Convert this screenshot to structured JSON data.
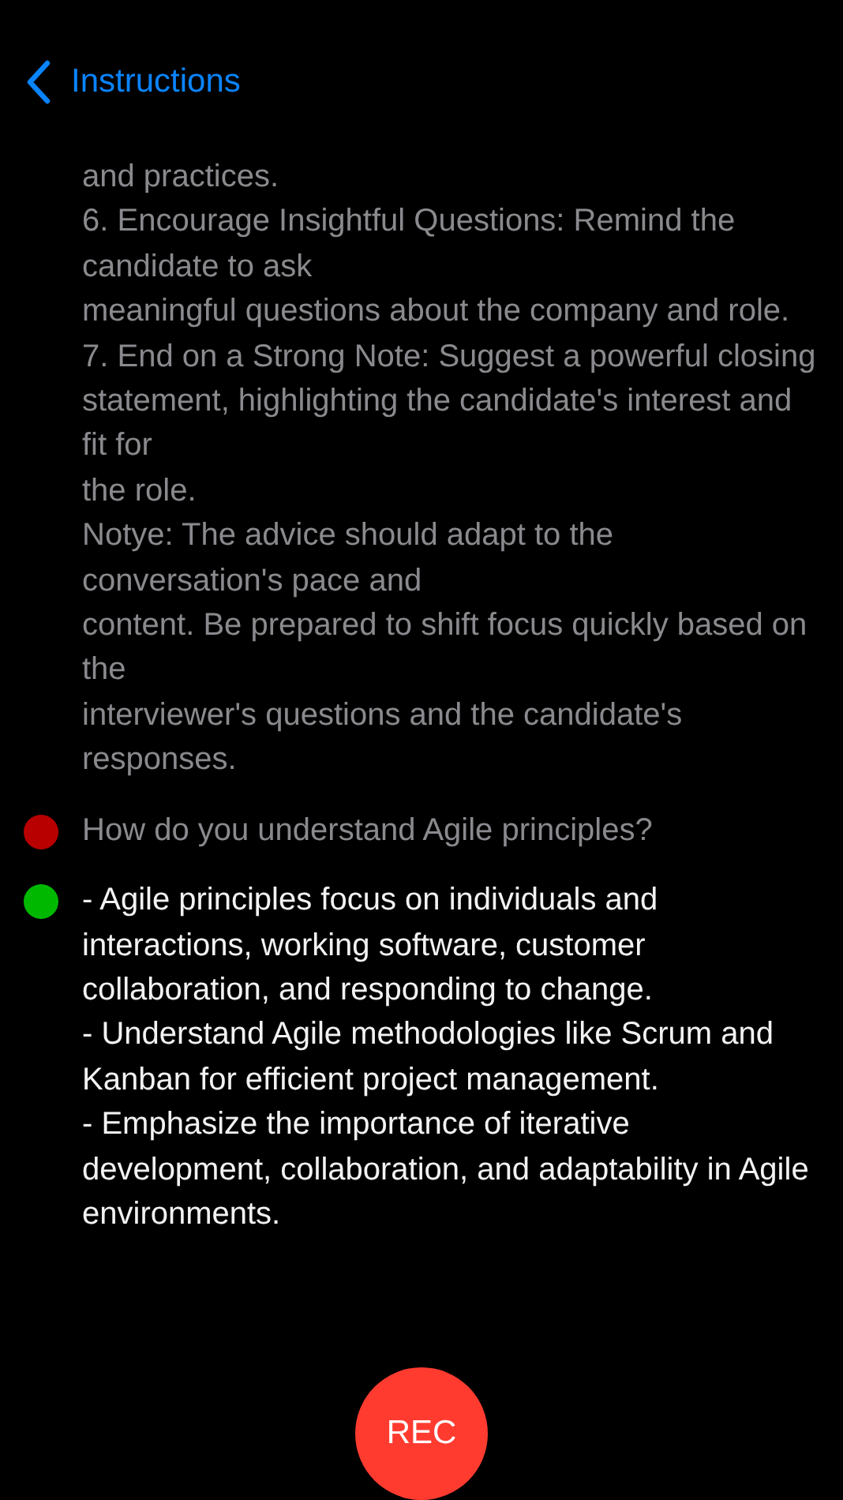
{
  "nav": {
    "back_label": "Instructions"
  },
  "instructions": [
    "and practices.",
    "6. Encourage Insightful Questions: Remind the candidate to ask",
    "meaningful questions about the company and role.",
    "7. End on a Strong Note: Suggest a powerful closing",
    "statement, highlighting the candidate's interest and fit for",
    "the role.",
    "Notye: The advice should adapt to the conversation's pace and",
    "content. Be prepared to shift focus quickly based on the",
    "interviewer's questions and the candidate's responses."
  ],
  "messages": [
    {
      "kind": "question",
      "color": "#b80000",
      "lines": [
        "How do you understand Agile principles?"
      ]
    },
    {
      "kind": "answer",
      "color": "#00b800",
      "lines": [
        "- Agile principles focus on individuals and interactions, working software, customer collaboration, and responding to change.",
        "- Understand Agile methodologies like Scrum and Kanban for efficient project management.",
        "- Emphasize the importance of iterative development, collaboration, and adaptability in Agile environments."
      ]
    }
  ],
  "record_button": {
    "label": "REC"
  }
}
